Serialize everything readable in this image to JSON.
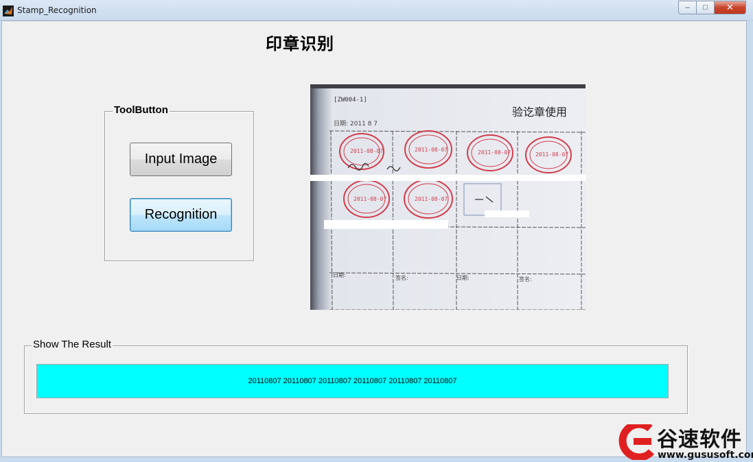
{
  "window": {
    "title": "Stamp_Recognition",
    "controls": {
      "minimize": "–",
      "maximize": "□",
      "close": "✕"
    }
  },
  "main": {
    "heading": "印章识别",
    "tool_group": {
      "title": "ToolButton",
      "input_button": "Input Image",
      "recognition_button": "Recognition"
    },
    "image": {
      "doc_code": "[ZW004-1]",
      "doc_title": "验讫章使用",
      "stamp_dates": [
        "2011-08-07",
        "2011-08-07",
        "2011-08-07",
        "2011-08-07",
        "2011-08-07",
        "2011-08-07"
      ]
    },
    "result_group": {
      "title": "Show The Result",
      "result_text": "20110807 20110807 20110807 20110807 20110807 20110807"
    }
  },
  "watermark": {
    "name": "谷速软件",
    "url": "www.gususoft.com"
  },
  "colors": {
    "result_background": "#00ffff",
    "stamp_red": "#d23c4a",
    "close_red": "#c8432c",
    "watermark_red": "#e02020"
  }
}
